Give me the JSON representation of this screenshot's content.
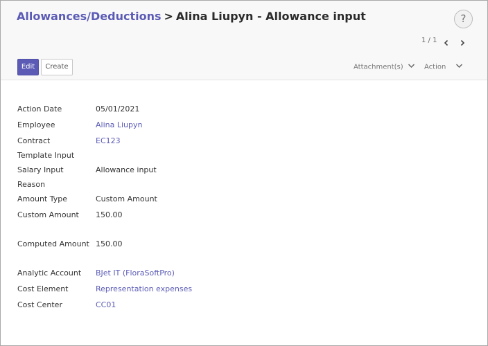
{
  "breadcrumb": {
    "parent": "Allowances/Deductions",
    "separator": ">",
    "current": "Alina Liupyn - Allowance input"
  },
  "help": {
    "label": "?"
  },
  "pager": {
    "text": "1 / 1"
  },
  "buttons": {
    "edit": "Edit",
    "create": "Create"
  },
  "dropdowns": {
    "attachments": "Attachment(s)",
    "action": "Action"
  },
  "fields": {
    "action_date": {
      "label": "Action Date",
      "value": "05/01/2021"
    },
    "employee": {
      "label": "Employee",
      "value": "Alina Liupyn"
    },
    "contract": {
      "label": "Contract",
      "value": "EC123"
    },
    "template_input": {
      "label": "Template Input",
      "value": ""
    },
    "salary_input": {
      "label": "Salary Input",
      "value": "Allowance input"
    },
    "reason": {
      "label": "Reason",
      "value": ""
    },
    "amount_type": {
      "label": "Amount Type",
      "value": "Custom Amount"
    },
    "custom_amount": {
      "label": "Custom Amount",
      "value": "150.00"
    },
    "computed_amount": {
      "label": "Computed Amount",
      "value": "150.00"
    },
    "analytic_account": {
      "label": "Analytic Account",
      "value": "BJet IT (FloraSoftPro)"
    },
    "cost_element": {
      "label": "Cost Element",
      "value": "Representation expenses"
    },
    "cost_center": {
      "label": "Cost Center",
      "value": "CC01"
    }
  },
  "colors": {
    "accent": "#5b5bb6",
    "panel_bg": "#f8f8f8"
  }
}
